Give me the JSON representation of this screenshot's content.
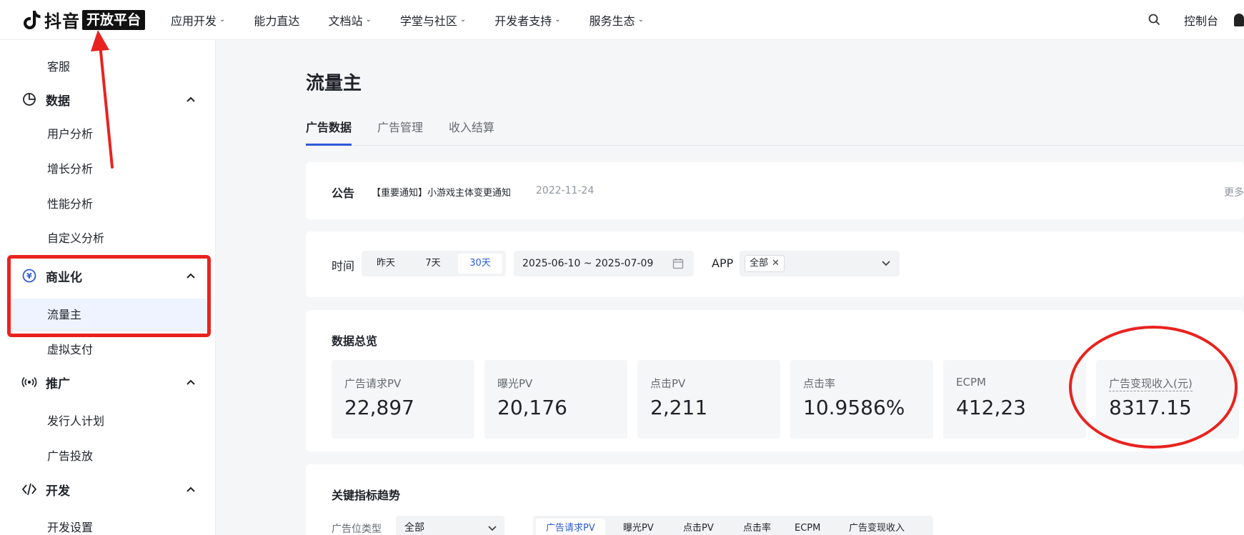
{
  "brand": {
    "name": "抖音",
    "badge": "开放平台"
  },
  "topnav": {
    "items": [
      {
        "label": "应用开发",
        "has_menu": true
      },
      {
        "label": "能力直达",
        "has_menu": false
      },
      {
        "label": "文档站",
        "has_menu": true
      },
      {
        "label": "学堂与社区",
        "has_menu": true
      },
      {
        "label": "开发者支持",
        "has_menu": true
      },
      {
        "label": "服务生态",
        "has_menu": true
      }
    ],
    "console": "控制台"
  },
  "sidebar": {
    "top_item": "客服",
    "groups": [
      {
        "label": "数据",
        "icon": "pie-chart-icon",
        "items": [
          "用户分析",
          "增长分析",
          "性能分析",
          "自定义分析"
        ]
      },
      {
        "label": "商业化",
        "icon": "yen-icon",
        "items": [
          "流量主",
          "虚拟支付"
        ],
        "active_item": "流量主"
      },
      {
        "label": "推广",
        "icon": "broadcast-icon",
        "items": [
          "发行人计划",
          "广告投放"
        ]
      },
      {
        "label": "开发",
        "icon": "code-icon",
        "items": [
          "开发设置"
        ]
      }
    ]
  },
  "page": {
    "title": "流量主",
    "tabs": [
      "广告数据",
      "广告管理",
      "收入结算"
    ],
    "active_tab": "广告数据"
  },
  "notice": {
    "label": "公告",
    "text": "【重要通知】小游戏主体变更通知",
    "date": "2022-11-24",
    "more": "更多"
  },
  "filters": {
    "time_label": "时间",
    "time_options": [
      "昨天",
      "7天",
      "30天"
    ],
    "active_time": "30天",
    "date_range": "2025-06-10 ~ 2025-07-09",
    "app_label": "APP",
    "app_tag": "全部"
  },
  "overview": {
    "title": "数据总览",
    "metrics": [
      {
        "label": "广告请求PV",
        "value": "22,897"
      },
      {
        "label": "曝光PV",
        "value": "20,176"
      },
      {
        "label": "点击PV",
        "value": "2,211"
      },
      {
        "label": "点击率",
        "value": "10.9586%"
      },
      {
        "label": "ECPM",
        "value": "412,23"
      },
      {
        "label": "广告变现收入(元)",
        "value": "8317.15"
      }
    ]
  },
  "trend": {
    "title": "关键指标趋势",
    "filter_label": "广告位类型",
    "filter_value": "全部",
    "tabs": [
      "广告请求PV",
      "曝光PV",
      "点击PV",
      "点击率",
      "ECPM",
      "广告变现收入"
    ],
    "active_tab": "广告请求PV"
  },
  "colors": {
    "accent": "#2c5ad8",
    "annotation": "#e8231f",
    "active_bg": "#eef3ff"
  }
}
